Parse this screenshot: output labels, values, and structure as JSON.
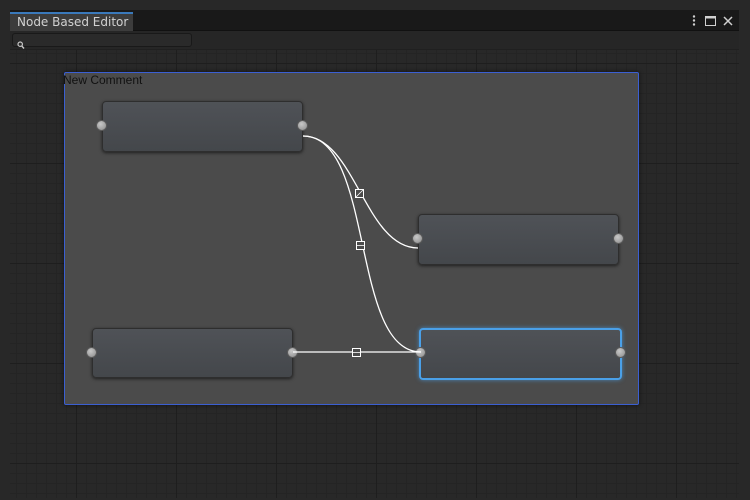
{
  "window": {
    "tab_title": "Node Based Editor",
    "actions": [
      {
        "name": "more-options",
        "glyph": "⋮"
      },
      {
        "name": "maximize",
        "glyph": "□"
      },
      {
        "name": "close",
        "glyph": "✕"
      }
    ]
  },
  "search": {
    "placeholder": "",
    "value": ""
  },
  "comment": {
    "title": "New Comment"
  },
  "colors": {
    "selection": "#4aa0e8",
    "comment_border": "#3b5fd2",
    "wire": "#ffffff"
  }
}
